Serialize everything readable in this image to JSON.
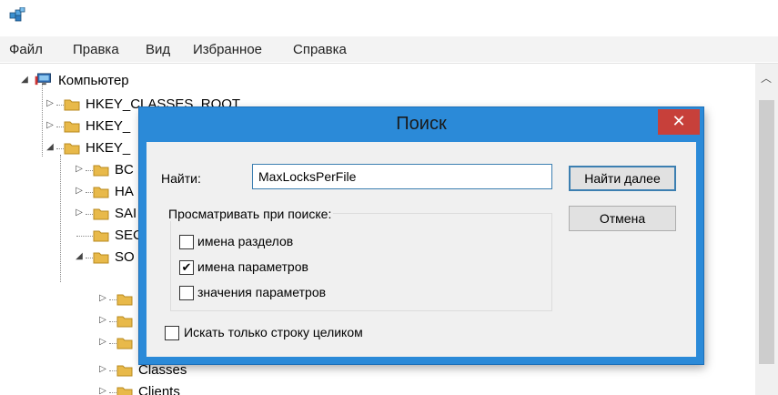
{
  "menu": [
    "Файл",
    "Правка",
    "Вид",
    "Избранное",
    "Справка"
  ],
  "tree": {
    "root": "Компьютер",
    "hives": [
      "HKEY_CLASSES_ROOT",
      "HKEY_",
      "HKEY_"
    ],
    "subkeys": [
      "BC",
      "HA",
      "SAI",
      "SEC",
      "SO"
    ],
    "children": [
      "Classes",
      "Clients"
    ]
  },
  "dialog": {
    "title": "Поиск",
    "close_glyph": "✕",
    "find_label": "Найти:",
    "find_value": "MaxLocksPerFile",
    "find_next": "Найти далее",
    "cancel": "Отмена",
    "group_title": "Просматривать при поиске:",
    "options": [
      {
        "label": "имена разделов",
        "checked": false
      },
      {
        "label": "имена параметров",
        "checked": true
      },
      {
        "label": "значения параметров",
        "checked": false
      }
    ],
    "match_whole": {
      "label": "Искать только строку целиком",
      "checked": false
    }
  },
  "icons": {
    "app": "registry-editor-icon",
    "computer": "computer-icon",
    "folder": "folder-icon"
  },
  "colors": {
    "dialog_frame": "#2b8ad8",
    "close_button": "#c7403a",
    "folder": "#e8b94a"
  }
}
